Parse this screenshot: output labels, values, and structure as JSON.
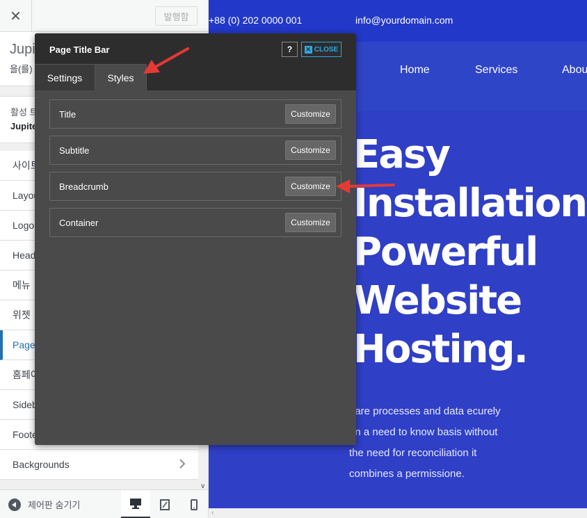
{
  "sidebar": {
    "close_glyph": "✕",
    "publish_label": "발행함",
    "info_title": "Jupit",
    "info_sub": "을(를)",
    "active_line1": "활성 트",
    "active_line2": "Jupite",
    "items": [
      {
        "label": "사이트"
      },
      {
        "label": "Layou"
      },
      {
        "label": "Logo"
      },
      {
        "label": "Head"
      },
      {
        "label": "메뉴"
      },
      {
        "label": "위젯"
      },
      {
        "label": "Page"
      },
      {
        "label": "홈페이"
      },
      {
        "label": "Sideb"
      },
      {
        "label": "Foote"
      },
      {
        "label": "Backgrounds"
      }
    ],
    "hide_label": "제어판 숨기기"
  },
  "preview": {
    "phone": "+88 (0) 202 0000 001",
    "email": "info@yourdomain.com",
    "nav": [
      "Home",
      "Services",
      "Abou"
    ],
    "hero_lines": [
      "Easy",
      "Installation",
      "Powerful",
      "Website",
      "Hosting."
    ],
    "hero_text": "hare processes and data ecurely on a need to know basis without the need for reconciliation it combines a permissione."
  },
  "dialog": {
    "title": "Page Title Bar",
    "help_label": "?",
    "close_label": "CLOSE",
    "tabs": [
      {
        "label": "Settings"
      },
      {
        "label": "Styles"
      }
    ],
    "rows": [
      {
        "label": "Title",
        "button": "Customize"
      },
      {
        "label": "Subtitle",
        "button": "Customize"
      },
      {
        "label": "Breadcrumb",
        "button": "Customize"
      },
      {
        "label": "Container",
        "button": "Customize"
      }
    ]
  },
  "colors": {
    "annotation_arrow": "#e53935",
    "accent": "#2ea7e0",
    "preview_bg": "#2f3fc6"
  }
}
